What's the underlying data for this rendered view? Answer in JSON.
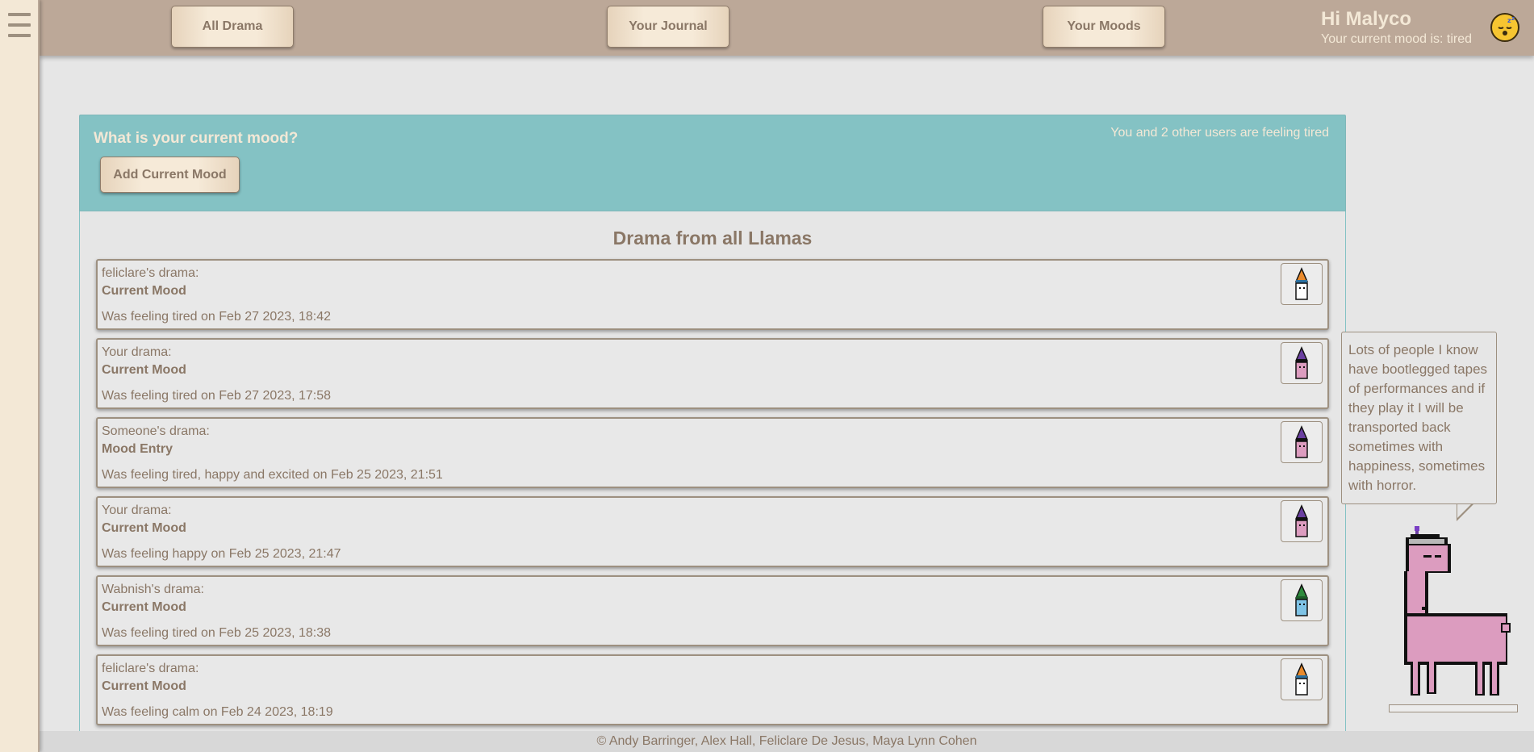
{
  "menu": {
    "icon": "hamburger-menu-icon"
  },
  "nav": {
    "all_drama": "All Drama",
    "your_journal": "Your Journal",
    "your_moods": "Your Moods"
  },
  "user": {
    "greeting": "Hi Malyco",
    "mood_status": "Your current mood is: tired",
    "mood_icon": "sleepy-face-icon"
  },
  "mood_panel": {
    "question": "What is your current mood?",
    "add_button": "Add Current Mood",
    "shared_count_text": "You and 2 other users are feeling tired"
  },
  "feed": {
    "title": "Drama from all Llamas",
    "entries": [
      {
        "owner": "feliclare's drama:",
        "title": "Current Mood",
        "desc": "Was feeling tired on Feb 27 2023, 18:42",
        "avatar": "llama-party-hat-avatar"
      },
      {
        "owner": "Your drama:",
        "title": "Current Mood",
        "desc": "Was feeling tired on Feb 27 2023, 17:58",
        "avatar": "llama-crown-avatar"
      },
      {
        "owner": "Someone's drama:",
        "title": "Mood Entry",
        "desc": "Was feeling tired, happy and excited on Feb 25 2023, 21:51",
        "avatar": "llama-crown-avatar"
      },
      {
        "owner": "Your drama:",
        "title": "Current Mood",
        "desc": "Was feeling happy on Feb 25 2023, 21:47",
        "avatar": "llama-crown-avatar"
      },
      {
        "owner": "Wabnish's drama:",
        "title": "Current Mood",
        "desc": "Was feeling tired on Feb 25 2023, 18:38",
        "avatar": "llama-green-cap-avatar"
      },
      {
        "owner": "feliclare's drama:",
        "title": "Current Mood",
        "desc": "Was feeling calm on Feb 24 2023, 18:19",
        "avatar": "llama-party-hat-avatar"
      }
    ]
  },
  "speech_bubble": {
    "text": "Lots of people I know have bootlegged tapes of performances and if they play it I will be transported back sometimes with happiness, sometimes with horror."
  },
  "footer": {
    "credits": "© Andy Barringer, Alex Hall, Feliclare De Jesus, Maya Lynn Cohen"
  },
  "colors": {
    "topbar": "#bca898",
    "accent_teal": "#84c2c4",
    "cream": "#f3e8d6",
    "text_brown": "#8a7766",
    "llama_pink": "#dc9cbf"
  }
}
